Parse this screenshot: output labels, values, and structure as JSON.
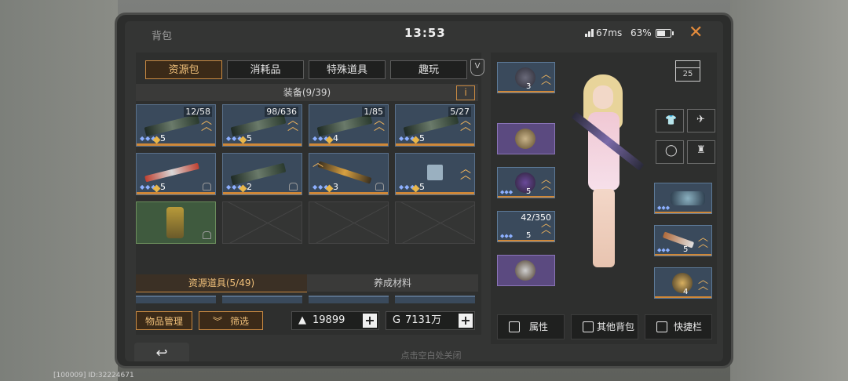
{
  "topbar": {
    "title": "背包",
    "clock": "13:53",
    "ping": "67ms",
    "battery": "63%",
    "battery_level": 0.63,
    "close_icon": "close-x"
  },
  "tabs": [
    {
      "label": "资源包",
      "active": true
    },
    {
      "label": "消耗品",
      "active": false
    },
    {
      "label": "特殊道具",
      "active": false
    },
    {
      "label": "趣玩",
      "active": false
    }
  ],
  "equipment_section": {
    "title": "装备(9/39)",
    "info_label": "i"
  },
  "equipment_items": [
    {
      "count": "12/58",
      "level": "5"
    },
    {
      "count": "98/636",
      "level": "5"
    },
    {
      "count": "1/85",
      "level": "4"
    },
    {
      "count": "5/27",
      "level": "5"
    },
    {
      "count": "",
      "level": "5"
    },
    {
      "count": "",
      "level": "2"
    },
    {
      "count": "",
      "level": "3"
    },
    {
      "count": "",
      "level": "5"
    },
    {
      "count": "",
      "level": ""
    }
  ],
  "subtabs": [
    {
      "label": "资源道具(5/49)",
      "active": true
    },
    {
      "label": "养成材料",
      "active": false
    }
  ],
  "actions": {
    "manage": "物品管理",
    "filter": "筛选"
  },
  "currency": {
    "diamonds": "19899",
    "coins": "7131万"
  },
  "character_slots": {
    "shop_level": "25",
    "left": [
      {
        "level": "3"
      },
      {
        "level": ""
      },
      {
        "level": "5"
      },
      {
        "count": "42/350",
        "level": "5"
      },
      {
        "level": ""
      }
    ],
    "right": [
      {
        "level": ""
      },
      {
        "level": "5"
      },
      {
        "level": "4"
      }
    ]
  },
  "right_buttons": [
    {
      "label": "属性",
      "icon": "person-icon"
    },
    {
      "label": "其他背包",
      "icon": "bag-icon"
    },
    {
      "label": "快捷栏",
      "icon": "grid-icon"
    }
  ],
  "bottom": {
    "back_icon": "↩",
    "hint": "点击空白处关闭"
  },
  "footer": {
    "id_text": "[100009] ID:32224671"
  },
  "colors": {
    "accent": "#c98a42",
    "panel": "#2e2f2e",
    "rare_blue": "#3a4a5c",
    "epic_purple": "#5b4a80"
  }
}
